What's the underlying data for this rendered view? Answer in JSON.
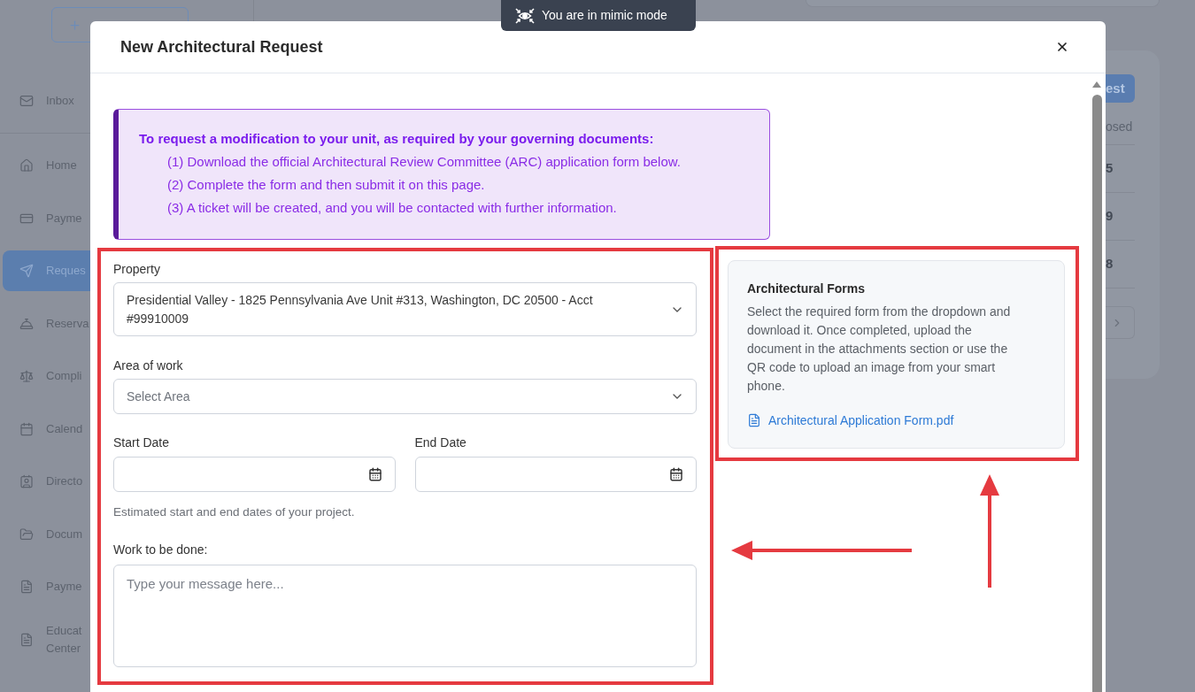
{
  "sidebar": {
    "items": [
      {
        "label": "Inbox",
        "selected": false
      },
      {
        "label": "Home",
        "selected": false
      },
      {
        "label": "Payme",
        "selected": false
      },
      {
        "label": "Reques",
        "selected": true
      },
      {
        "label": "Reserva",
        "selected": false
      },
      {
        "label": "Compli",
        "selected": false
      },
      {
        "label": "Calend",
        "selected": false
      },
      {
        "label": "Directo",
        "selected": false
      },
      {
        "label": "Docum",
        "selected": false
      },
      {
        "label": "Payme",
        "selected": false
      },
      {
        "label": "Educat Center",
        "selected": false
      }
    ]
  },
  "right_panel": {
    "button": "est",
    "column_header": "osed",
    "cells": [
      "5",
      "9",
      "8"
    ]
  },
  "mimic_banner": {
    "text": "You are in mimic mode"
  },
  "modal": {
    "title": "New Architectural Request",
    "notice": {
      "heading": "To request a modification to your unit, as required by your governing documents:",
      "steps": [
        "(1) Download the official Architectural Review Committee (ARC) application form below.",
        "(2) Complete the form and then submit it on this page.",
        "(3) A ticket will be created, and you will be contacted with further information."
      ]
    },
    "form": {
      "property": {
        "label": "Property",
        "value": "Presidential Valley - 1825 Pennsylvania Ave Unit #313, Washington, DC 20500 - Acct #99910009"
      },
      "area_of_work": {
        "label": "Area of work",
        "placeholder": "Select Area"
      },
      "start_date": {
        "label": "Start Date"
      },
      "end_date": {
        "label": "End Date"
      },
      "date_hint": "Estimated start and end dates of your project.",
      "work": {
        "label": "Work to be done:",
        "placeholder": "Type your message here..."
      }
    },
    "forms_card": {
      "title": "Architectural Forms",
      "description": "Select the required form from the dropdown and download it. Once completed, upload the document in the attachments section or use the QR code to upload an image from your smart phone.",
      "link": "Architectural Application Form.pdf"
    }
  }
}
